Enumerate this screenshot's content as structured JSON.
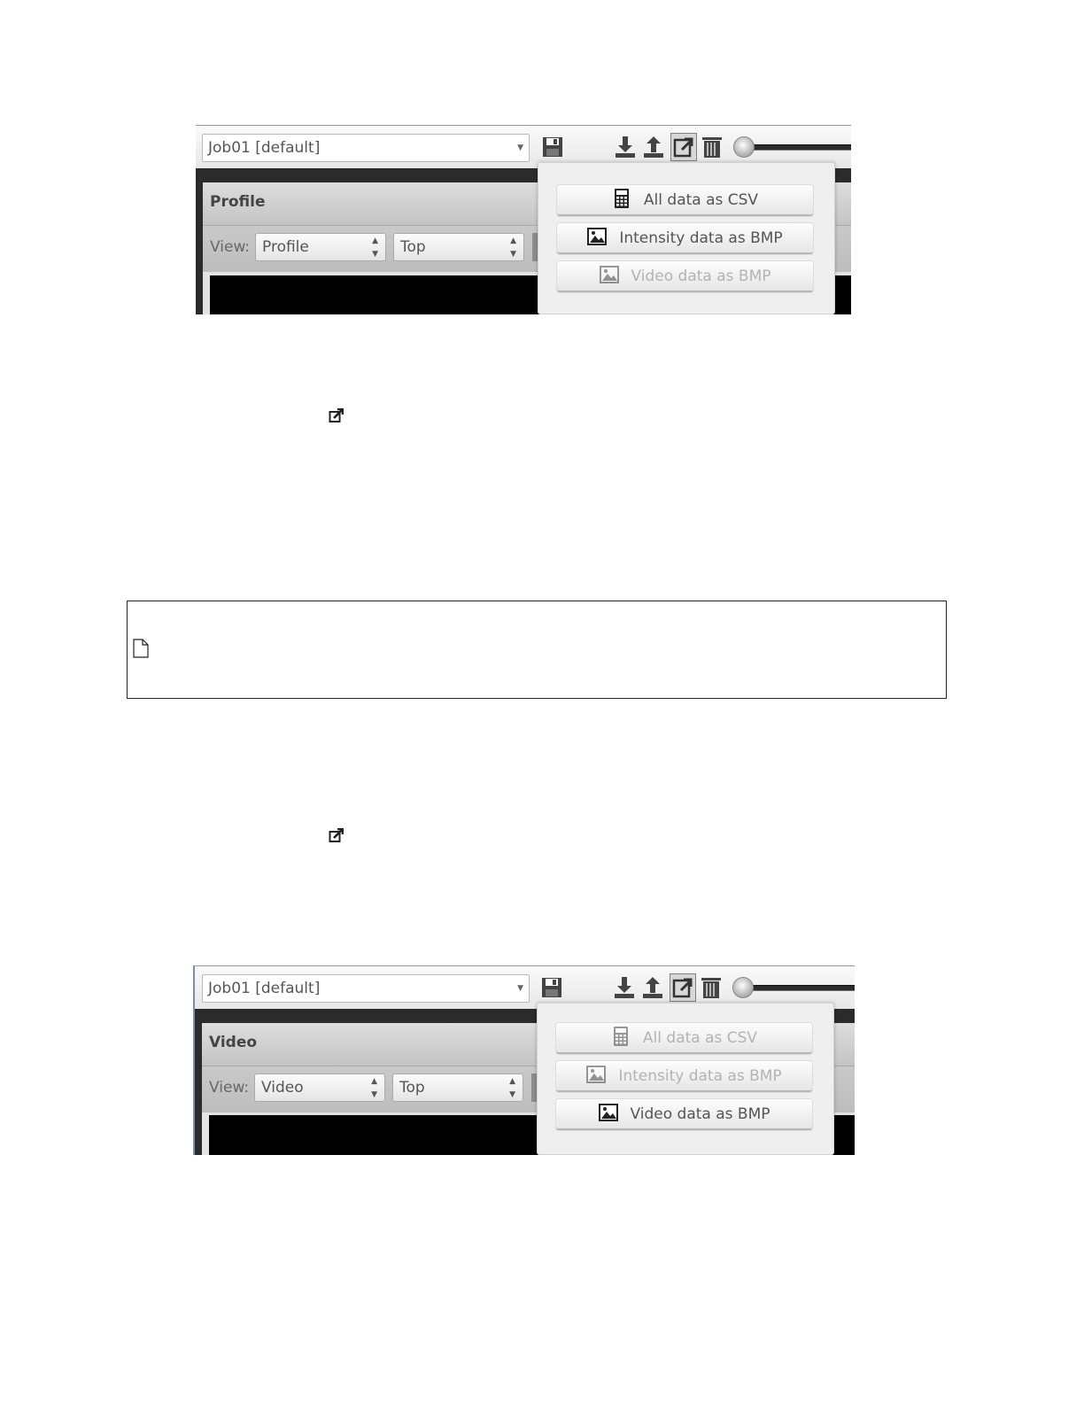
{
  "screenshot_profile": {
    "job_select": "Job01 [default]",
    "panel_title": "Profile",
    "view_label": "View:",
    "view_select_1": "Profile",
    "view_select_2": "Top",
    "dropdown": [
      {
        "label": "All data as CSV",
        "icon": "calculator-icon",
        "enabled": true
      },
      {
        "label": "Intensity data as BMP",
        "icon": "image-icon",
        "enabled": true
      },
      {
        "label": "Video data as BMP",
        "icon": "image-icon",
        "enabled": false
      }
    ]
  },
  "screenshot_video": {
    "job_select": "Job01 [default]",
    "panel_title": "Video",
    "view_label": "View:",
    "view_select_1": "Video",
    "view_select_2": "Top",
    "dropdown": [
      {
        "label": "All data as CSV",
        "icon": "calculator-icon",
        "enabled": false
      },
      {
        "label": "Intensity data as BMP",
        "icon": "image-icon",
        "enabled": false
      },
      {
        "label": "Video data as BMP",
        "icon": "image-icon",
        "enabled": true
      }
    ]
  },
  "toolbar_icons": [
    "save-icon",
    "download-icon",
    "upload-icon",
    "export-icon",
    "trash-icon",
    "slider-knob"
  ],
  "inline_icon": "export-icon",
  "placeholder_icon": "document-icon",
  "colors": {
    "dropdown_enabled_text": "#555555",
    "dropdown_disabled_text": "#b3b3b3"
  }
}
